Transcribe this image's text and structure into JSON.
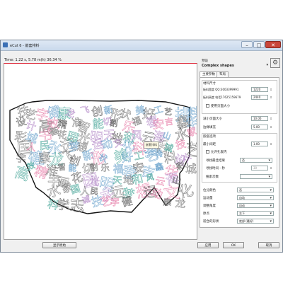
{
  "window": {
    "title": "eCut 6 - 嵌套排料"
  },
  "status": {
    "time_label": "Time: 1.22 s, 5.78 m(h)  36.34 %"
  },
  "tooltip": "嵌套排料",
  "preset": {
    "label": "预设",
    "name": "Complex shapes",
    "gear_icon": "gear-icon"
  },
  "tabs": [
    {
      "label": "主要参数"
    },
    {
      "label": "布局"
    }
  ],
  "material": {
    "section": "材料尺寸",
    "width_label": "板料宽度  QQ:3003399991",
    "width_value": "1220",
    "height_label": "板料高度  电话17625159679",
    "height_value": "2440",
    "use_page_size": "使用页面大小"
  },
  "margins": {
    "reduce_label": "减小页面大小",
    "reduce_value": "10.00",
    "gap_label": "边缘填充",
    "gap_value": "5.00"
  },
  "nest": {
    "section": "嵌套选项",
    "min_gap_label": "最小间距",
    "min_gap_value": "1.00",
    "allow_holes": "允许孔嵌内",
    "stop_early_label": "寻找最佳结果",
    "stop_early_value": "否",
    "time_label": "寻找时间 - 秒",
    "time_value": "30",
    "search_label": "搜索次数",
    "search_value": ""
  },
  "layout": {
    "color_label": "位分颜色",
    "color_value": "否",
    "run_label": "运动量",
    "run_value": "自动",
    "rotate_label": "调整角度",
    "rotate_value": "自动",
    "origin_label": "原点",
    "origin_value": "左下",
    "shape_label": "适合的形状",
    "shape_value": "底部 (最好)"
  },
  "buttons": {
    "show_original": "显示原始",
    "apply": "应用",
    "ok": "OK",
    "cancel": "取消"
  },
  "canvas_glyphs": [
    "技",
    "艺",
    "字",
    "健",
    "康",
    "龙",
    "飞",
    "创",
    "新",
    "形",
    "状",
    "美",
    "好",
    "工",
    "艺",
    "排",
    "料",
    "设",
    "计",
    "高",
    "效",
    "精",
    "准",
    "智",
    "能",
    "切",
    "割",
    "乐",
    "福",
    "春",
    "安",
    "吉",
    "鑫",
    "华",
    "彩",
    "城",
    "书",
    "画",
    "花",
    "园",
    "光",
    "明",
    "天",
    "地",
    "和",
    "风",
    "云",
    "海",
    "山",
    "水",
    "家",
    "国",
    "人",
    "民",
    "永",
    "远",
    "梦",
    "想",
    "运",
    "动",
    "文",
    "化",
    "科",
    "学",
    "志",
    "诚"
  ],
  "accent_colors": {
    "close": "#c9453a",
    "canvas_border": "#d23",
    "pink": "#e77da8",
    "blue": "#6aa2cc",
    "teal": "#4aa79a"
  }
}
